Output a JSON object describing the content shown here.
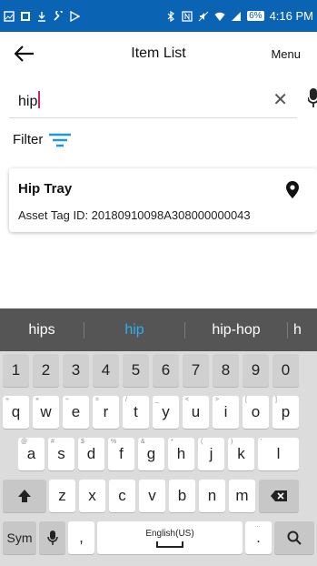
{
  "status_bar": {
    "battery": "6%",
    "time": "4:16 PM"
  },
  "app_bar": {
    "title": "Item List",
    "menu_label": "Menu"
  },
  "search": {
    "value": "hip"
  },
  "filter": {
    "label": "Filter"
  },
  "results": [
    {
      "name": "Hip Tray",
      "asset_tag": "Asset Tag ID: 20180910098A308000000043"
    }
  ],
  "keyboard": {
    "suggestions": [
      "hips",
      "hip",
      "hip-hop",
      "h"
    ],
    "number_row": [
      "1",
      "2",
      "3",
      "4",
      "5",
      "6",
      "7",
      "8",
      "9",
      "0"
    ],
    "row1": [
      "q",
      "w",
      "e",
      "r",
      "t",
      "y",
      "u",
      "i",
      "o",
      "p"
    ],
    "row2": [
      "a",
      "s",
      "d",
      "f",
      "g",
      "h",
      "j",
      "k",
      "l"
    ],
    "row3": [
      "z",
      "x",
      "c",
      "v",
      "b",
      "n",
      "m"
    ],
    "row1_hints": [
      "+",
      "×",
      "÷",
      "=",
      "/",
      "_",
      "<",
      ">",
      "[",
      "]"
    ],
    "row2_hints": [
      "@",
      "#",
      "$",
      "%",
      "&",
      "*",
      "(",
      ")",
      "'"
    ],
    "sym_label": "Sym",
    "comma": ",",
    "language": "English(US)",
    "period": ".",
    "period_hint": "…"
  },
  "colors": {
    "status_bar": "#0b63b3",
    "accent": "#1a9ad6",
    "caret": "#d0246a",
    "suggestion_strip": "#555555"
  }
}
